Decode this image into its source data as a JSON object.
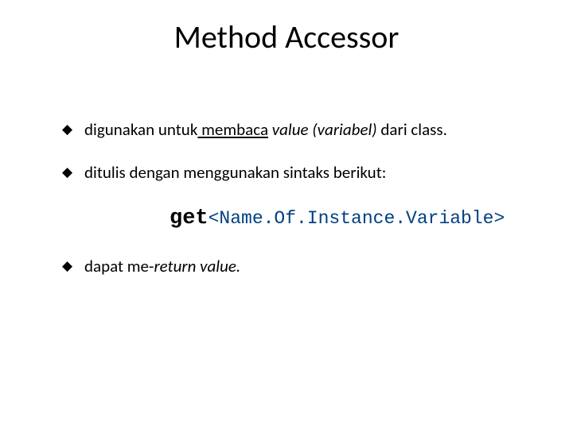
{
  "title": "Method Accessor",
  "bullets": {
    "b1": {
      "pre": "digunakan untuk",
      "underline_space": " ",
      "underline_word": "membaca",
      "italic_part": " value (variabel)",
      "post": " dari class."
    },
    "b2": "ditulis dengan menggunakan sintaks berikut:",
    "b3": {
      "pre": "dapat me-",
      "italic_part": "return value."
    }
  },
  "code": {
    "get": "get",
    "placeholder": "<Name.Of.Instance.Variable>"
  }
}
